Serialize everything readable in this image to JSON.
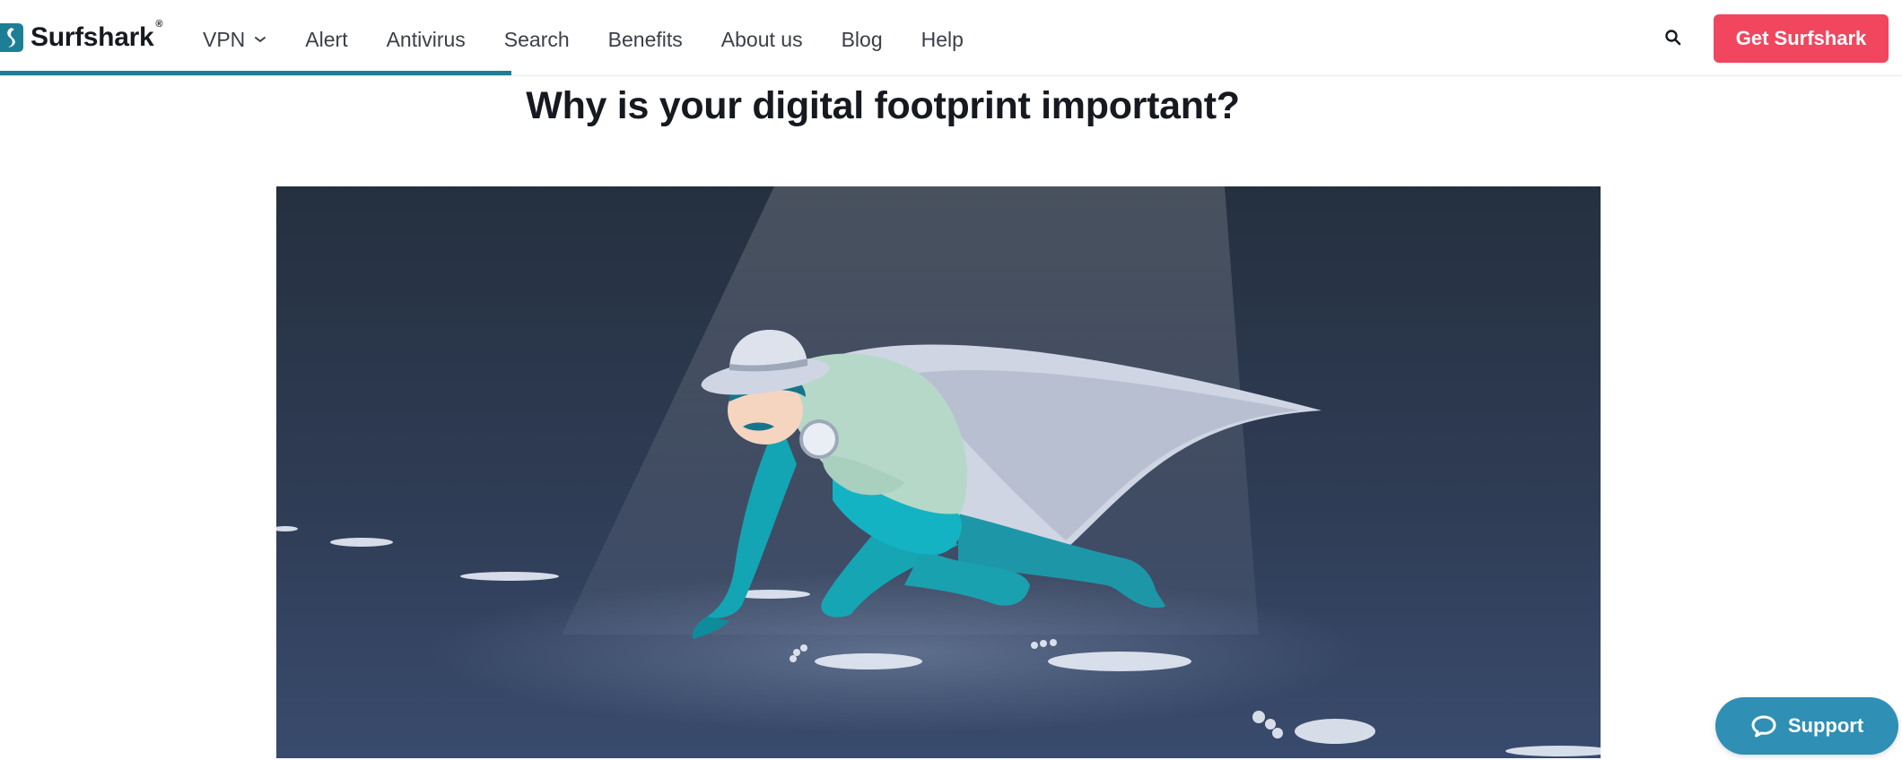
{
  "brand": {
    "name": "Surfshark",
    "registered": "®",
    "accent": "#1c7f96"
  },
  "nav": {
    "items": [
      {
        "label": "VPN",
        "has_dropdown": true
      },
      {
        "label": "Alert"
      },
      {
        "label": "Antivirus"
      },
      {
        "label": "Search"
      },
      {
        "label": "Benefits"
      },
      {
        "label": "About us"
      },
      {
        "label": "Blog"
      },
      {
        "label": "Help"
      }
    ]
  },
  "header": {
    "search_icon": "search-icon",
    "cta_label": "Get Surfshark",
    "cta_color": "#f2455e",
    "reading_progress": 0.27
  },
  "article": {
    "heading": "Why is your digital footprint important?",
    "illustration": "detective-with-magnifying-glass"
  },
  "support": {
    "label": "Support",
    "icon": "chat-bubble-icon",
    "color": "#2f8fb4"
  }
}
